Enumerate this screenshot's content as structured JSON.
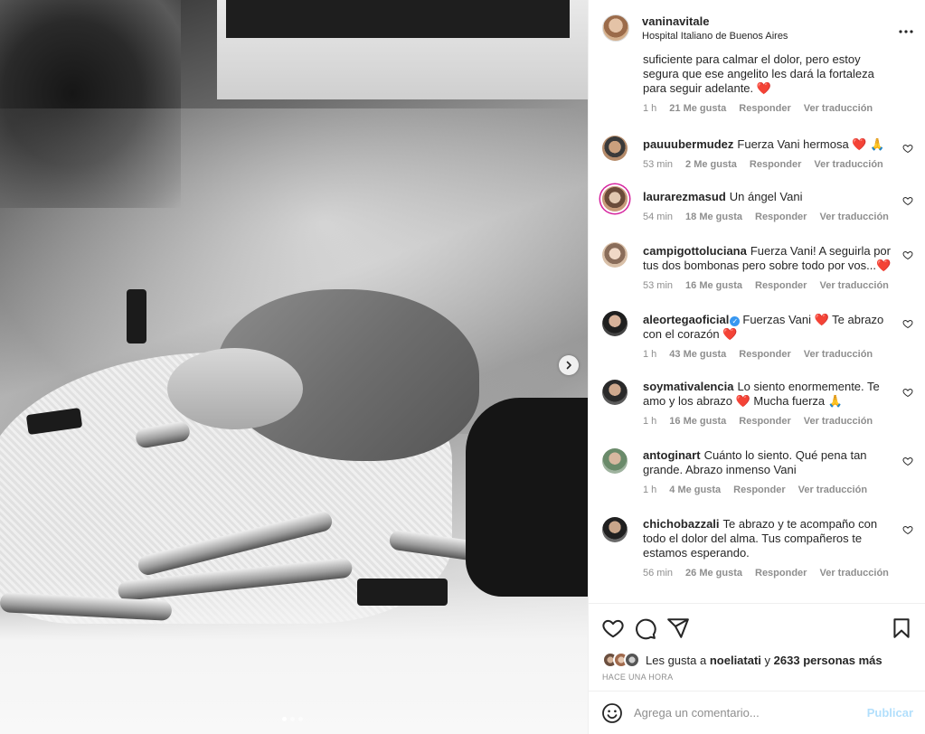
{
  "post": {
    "username": "vaninavitale",
    "location": "Hospital Italiano de Buenos Aires",
    "more_icon": "more-horizontal-icon"
  },
  "photo": {
    "alt": "Fotografía en blanco y negro",
    "carousel": {
      "current": 1,
      "total": 3
    },
    "next_icon": "chevron-right-icon"
  },
  "comments": [
    {
      "username": "",
      "text": "suficiente para calmar el dolor, pero estoy segura que ese angelito les dará la fortaleza para seguir adelante. ❤️",
      "time": "1 h",
      "likes": "21 Me gusta",
      "reply": "Responder",
      "translate": "Ver traducción"
    },
    {
      "username": "pauuubermudez",
      "text": "Fuerza Vani hermosa ❤️ 🙏",
      "time": "53 min",
      "likes": "2 Me gusta",
      "reply": "Responder",
      "translate": "Ver traducción"
    },
    {
      "username": "laurarezmasud",
      "text": "Un ángel Vani",
      "time": "54 min",
      "likes": "18 Me gusta",
      "reply": "Responder",
      "translate": "Ver traducción"
    },
    {
      "username": "campigottoluciana",
      "text": "Fuerza Vani! A seguirla por tus dos bombonas pero sobre todo por vos...❤️",
      "time": "53 min",
      "likes": "16 Me gusta",
      "reply": "Responder",
      "translate": "Ver traducción"
    },
    {
      "username": "aleortegaoficial",
      "verified": true,
      "text": "Fuerzas Vani ❤️ Te abrazo con el corazón ❤️",
      "time": "1 h",
      "likes": "43 Me gusta",
      "reply": "Responder",
      "translate": "Ver traducción"
    },
    {
      "username": "soymativalencia",
      "text": "Lo siento enormemente. Te amo y los abrazo ❤️ Mucha fuerza 🙏",
      "time": "1 h",
      "likes": "16 Me gusta",
      "reply": "Responder",
      "translate": "Ver traducción"
    },
    {
      "username": "antoginart",
      "text": "Cuánto lo siento. Qué pena tan grande. Abrazo inmenso Vani",
      "time": "1 h",
      "likes": "4 Me gusta",
      "reply": "Responder",
      "translate": "Ver traducción"
    },
    {
      "username": "chichobazzali",
      "text": "Te abrazo y te acompaño con todo el dolor del alma. Tus compañeros te estamos esperando.",
      "time": "56 min",
      "likes": "26 Me gusta",
      "reply": "Responder",
      "translate": "Ver traducción"
    }
  ],
  "actions": {
    "like_icon": "heart-outline-icon",
    "comment_icon": "comment-bubble-icon",
    "share_icon": "paper-plane-icon",
    "save_icon": "bookmark-icon"
  },
  "likes_summary": {
    "prefix": "Les gusta a",
    "user": "noeliatati",
    "connector": "y",
    "others": "2633 personas más"
  },
  "timestamp": "HACE UNA HORA",
  "add_comment": {
    "placeholder": "Agrega un comentario...",
    "publish": "Publicar",
    "emoji_icon": "smiley-face-icon"
  },
  "colors": {
    "text": "#262626",
    "secondary": "#8e8e8e",
    "heart": "#ed4956",
    "publish_disabled": "#b2dffc",
    "verified": "#3897f0"
  }
}
